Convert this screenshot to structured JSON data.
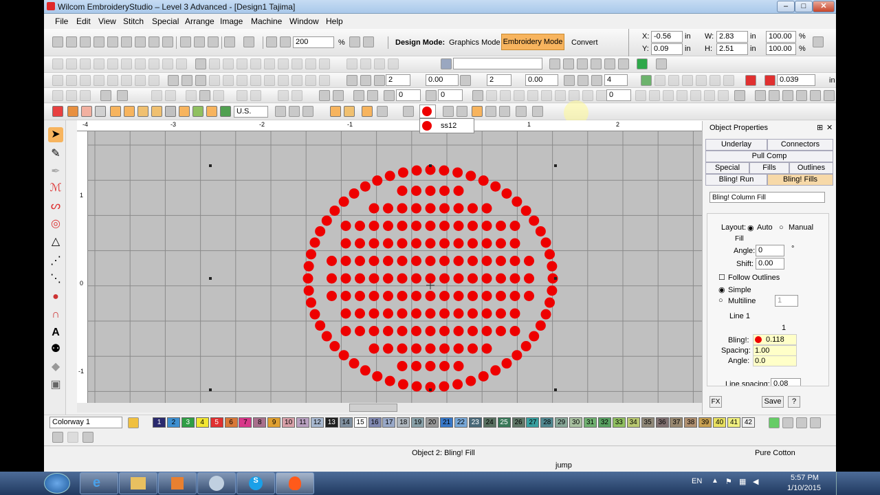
{
  "window": {
    "title": "Wilcom EmbroideryStudio – Level 3 Advanced - [Design1          Tajima]",
    "min": "–",
    "max": "□",
    "close": "✕"
  },
  "menu": [
    "File",
    "Edit",
    "View",
    "Stitch",
    "Special",
    "Arrange",
    "Image",
    "Machine",
    "Window",
    "Help"
  ],
  "toolbar1": {
    "zoom": "200",
    "zoom_unit": "%",
    "design_mode_label": "Design Mode:",
    "graphics_mode": "Graphics Mode",
    "embroidery_mode": "Embroidery Mode",
    "convert": "Convert"
  },
  "coords": {
    "x_label": "X:",
    "x": "-0.56",
    "x_unit": "in",
    "y_label": "Y:",
    "y": "0.09",
    "y_unit": "in",
    "w_label": "W:",
    "w": "2.83",
    "w_unit": "in",
    "h_label": "H:",
    "h": "2.51",
    "h_unit": "in",
    "wp": "100.00",
    "hp": "100.00",
    "pct": "%"
  },
  "toolbar2": {
    "val1": "2",
    "val2": "0.00",
    "val3": "2",
    "val4": "0.00",
    "val5": "4",
    "val6": "0.039",
    "unit": "in"
  },
  "toolbar3": {
    "val1": "0",
    "val2": "0",
    "val3": "0"
  },
  "toolbar4": {
    "units": "U.S.",
    "popup_item": "ss12"
  },
  "ruler": {
    "top_labels": [
      "-4",
      "-3",
      "-2",
      "-1",
      "0",
      "1",
      "2"
    ],
    "left_labels": [
      "1",
      "0",
      "-1"
    ]
  },
  "props": {
    "title": "Object Properties",
    "pin": "⊞",
    "close": "✕",
    "tabs": [
      "Underlay",
      "Connectors",
      "Pull Comp",
      "Special",
      "Fills",
      "Outlines",
      "Bling! Run",
      "Bling! Fills"
    ],
    "fill_type": "Bling! Column Fill",
    "layout_label": "Layout:",
    "auto": "Auto",
    "manual": "Manual",
    "fill_label": "Fill",
    "angle_label": "Angle:",
    "angle": "0",
    "angle_unit": "°",
    "shift_label": "Shift:",
    "shift": "0.00",
    "follow": "Follow Outlines",
    "simple": "Simple",
    "multiline": "Multiline",
    "multiline_val": "1",
    "line1": "Line 1",
    "col_header": "1",
    "bling_label": "Bling!:",
    "bling_val": "0.118",
    "spacing_label": "Spacing:",
    "spacing_val": "1.00",
    "angle2_label": "Angle:",
    "angle2_val": "0.0",
    "line_spacing_label": "Line spacing:",
    "line_spacing_val": "0.08",
    "fx": "FX",
    "save": "Save",
    "help": "?"
  },
  "palette": {
    "colorway": "Colorway 1",
    "swatches": [
      {
        "n": "1",
        "c": "#2a2a6e"
      },
      {
        "n": "2",
        "c": "#3d8fd0"
      },
      {
        "n": "3",
        "c": "#2f9e45"
      },
      {
        "n": "4",
        "c": "#f2e632"
      },
      {
        "n": "5",
        "c": "#e03030"
      },
      {
        "n": "6",
        "c": "#d87838"
      },
      {
        "n": "7",
        "c": "#d8388a"
      },
      {
        "n": "8",
        "c": "#a8708c"
      },
      {
        "n": "9",
        "c": "#e0a030"
      },
      {
        "n": "10",
        "c": "#d8a0a8"
      },
      {
        "n": "11",
        "c": "#b8a0c0"
      },
      {
        "n": "12",
        "c": "#a8b8d0"
      },
      {
        "n": "13",
        "c": "#202020"
      },
      {
        "n": "14",
        "c": "#8090a0"
      },
      {
        "n": "15",
        "c": "#ffffff"
      },
      {
        "n": "16",
        "c": "#8088b0"
      },
      {
        "n": "17",
        "c": "#98a8c8"
      },
      {
        "n": "18",
        "c": "#b0b8c0"
      },
      {
        "n": "19",
        "c": "#88a0a8"
      },
      {
        "n": "20",
        "c": "#989898"
      },
      {
        "n": "21",
        "c": "#3878c8"
      },
      {
        "n": "22",
        "c": "#78a8d8"
      },
      {
        "n": "23",
        "c": "#486878"
      },
      {
        "n": "24",
        "c": "#587060"
      },
      {
        "n": "25",
        "c": "#387858"
      },
      {
        "n": "26",
        "c": "#607868"
      },
      {
        "n": "27",
        "c": "#38a0a0"
      },
      {
        "n": "28",
        "c": "#508890"
      },
      {
        "n": "29",
        "c": "#88a898"
      },
      {
        "n": "30",
        "c": "#a8c0a0"
      },
      {
        "n": "31",
        "c": "#70b070"
      },
      {
        "n": "32",
        "c": "#58a060"
      },
      {
        "n": "33",
        "c": "#90c060"
      },
      {
        "n": "34",
        "c": "#b8c870"
      },
      {
        "n": "35",
        "c": "#908878"
      },
      {
        "n": "36",
        "c": "#807070"
      },
      {
        "n": "37",
        "c": "#988870"
      },
      {
        "n": "38",
        "c": "#b09070"
      },
      {
        "n": "39",
        "c": "#c8a050"
      },
      {
        "n": "40",
        "c": "#e8e060"
      },
      {
        "n": "41",
        "c": "#f0f080"
      },
      {
        "n": "42",
        "c": "#f0f0f0"
      }
    ]
  },
  "status": {
    "object": "Object 2: Bling! Fill",
    "fabric": "Pure Cotton",
    "jump": "jump"
  },
  "taskbar": {
    "lang": "EN",
    "time": "5:57 PM",
    "date": "1/10/2015"
  }
}
